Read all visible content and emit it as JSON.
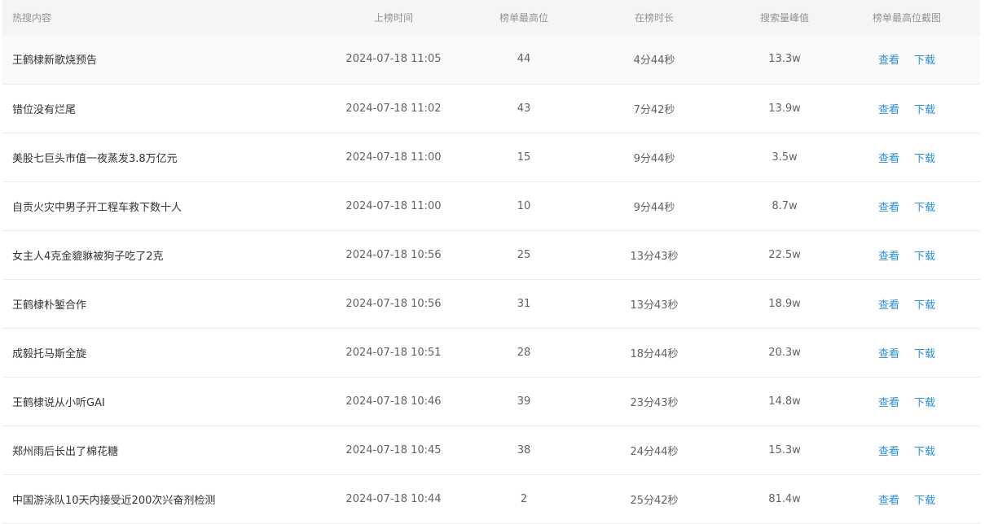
{
  "headers": {
    "topic": "热搜内容",
    "time": "上榜时间",
    "top_rank": "榜单最高位",
    "duration": "在榜时长",
    "peak": "搜索量峰值",
    "screenshot": "榜单最高位截图"
  },
  "action_labels": {
    "view": "查看",
    "download": "下载"
  },
  "rows": [
    {
      "topic": "王鹤棣新歌烧预告",
      "time": "2024-07-18 11:05",
      "rank": "44",
      "duration": "4分44秒",
      "peak": "13.3w",
      "view": "查看",
      "download": "下载"
    },
    {
      "topic": "错位没有烂尾",
      "time": "2024-07-18 11:02",
      "rank": "43",
      "duration": "7分42秒",
      "peak": "13.9w",
      "view": "查看",
      "download": "下载"
    },
    {
      "topic": "美股七巨头市值一夜蒸发3.8万亿元",
      "time": "2024-07-18 11:00",
      "rank": "15",
      "duration": "9分44秒",
      "peak": "3.5w",
      "view": "查看",
      "download": "下载"
    },
    {
      "topic": "自贡火灾中男子开工程车救下数十人",
      "time": "2024-07-18 11:00",
      "rank": "10",
      "duration": "9分44秒",
      "peak": "8.7w",
      "view": "查看",
      "download": "下载"
    },
    {
      "topic": "女主人4克金貔貅被狗子吃了2克",
      "time": "2024-07-18 10:56",
      "rank": "25",
      "duration": "13分43秒",
      "peak": "22.5w",
      "view": "查看",
      "download": "下载"
    },
    {
      "topic": "王鹤棣朴錾合作",
      "time": "2024-07-18 10:56",
      "rank": "31",
      "duration": "13分43秒",
      "peak": "18.9w",
      "view": "查看",
      "download": "下载"
    },
    {
      "topic": "成毅托马斯全旋",
      "time": "2024-07-18 10:51",
      "rank": "28",
      "duration": "18分44秒",
      "peak": "20.3w",
      "view": "查看",
      "download": "下载"
    },
    {
      "topic": "王鹤棣说从小听GAI",
      "time": "2024-07-18 10:46",
      "rank": "39",
      "duration": "23分43秒",
      "peak": "14.8w",
      "view": "查看",
      "download": "下载"
    },
    {
      "topic": "郑州雨后长出了棉花糖",
      "time": "2024-07-18 10:45",
      "rank": "38",
      "duration": "24分44秒",
      "peak": "15.3w",
      "view": "查看",
      "download": "下载"
    },
    {
      "topic": "中国游泳队10天内接受近200次兴奋剂检测",
      "time": "2024-07-18 10:44",
      "rank": "2",
      "duration": "25分42秒",
      "peak": "81.4w",
      "view": "查看",
      "download": "下载"
    }
  ],
  "colors": {
    "header_bg": "#f5f5f5",
    "link": "#2b8fd6",
    "text": "#606266",
    "header_text": "#909399"
  }
}
